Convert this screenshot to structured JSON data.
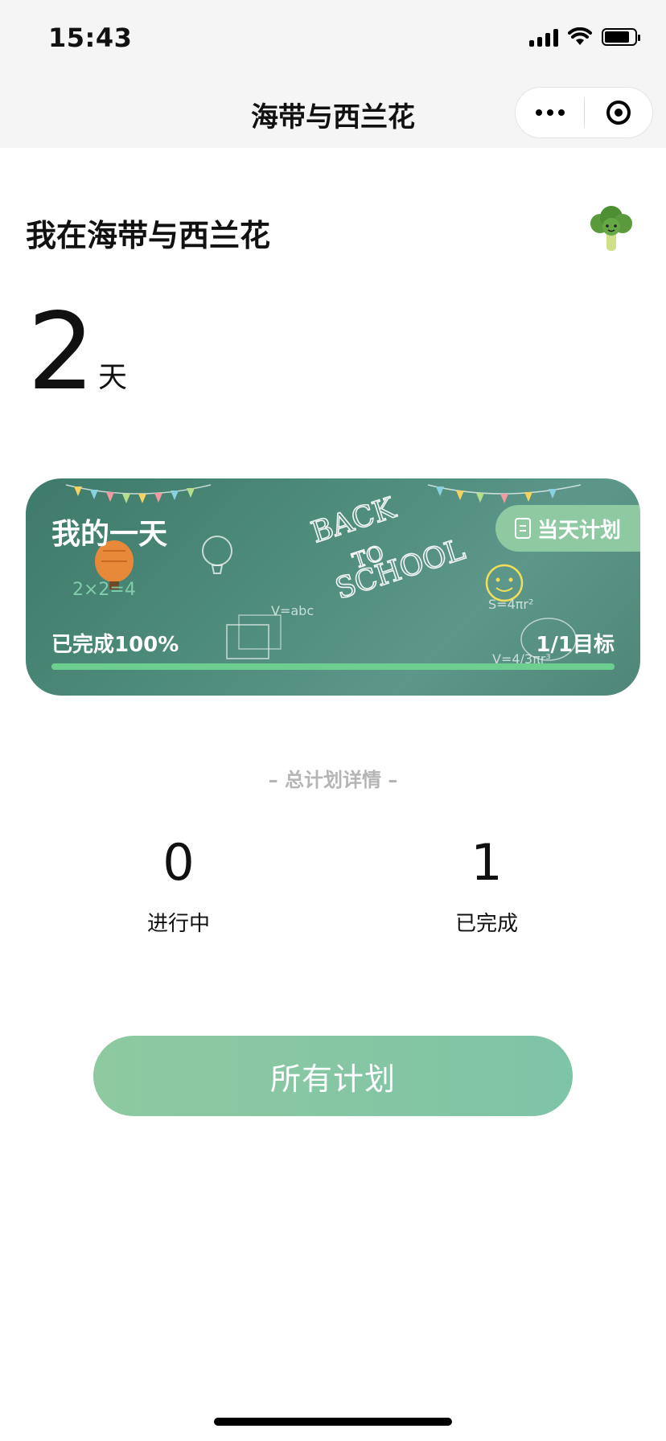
{
  "status_bar": {
    "time": "15:43"
  },
  "nav": {
    "title": "海带与西兰花",
    "more_icon": "more-dots-icon",
    "close_icon": "target-icon"
  },
  "header": {
    "title": "我在海带与西兰花",
    "mascot_icon": "broccoli-icon"
  },
  "days": {
    "value": "2",
    "unit": "天"
  },
  "card": {
    "title": "我的一天",
    "plan_button": "当天计划",
    "completed_text": "已完成100%",
    "goal_text": "1/1目标",
    "progress_fraction": 1.0,
    "background_text": "BACK TO SCHOOL"
  },
  "summary": {
    "section_label": "– 总计划详情 –",
    "in_progress": {
      "value": "0",
      "label": "进行中"
    },
    "completed": {
      "value": "1",
      "label": "已完成"
    }
  },
  "all_plans_button": "所有计划",
  "colors": {
    "accent": "#8fc9a1",
    "card_bg": "#4d8b7a",
    "progress": "#6ccf8f"
  }
}
